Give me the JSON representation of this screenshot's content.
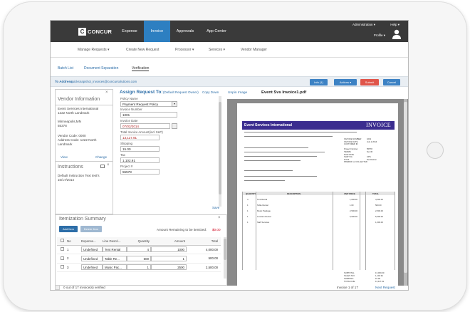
{
  "nav": {
    "logo": "CONCUR",
    "logo_icon_letter": "C",
    "tabs": [
      {
        "label": "Expense"
      },
      {
        "label": "Invoice"
      },
      {
        "label": "Approvals"
      },
      {
        "label": "App Center"
      }
    ],
    "administration": "Administration ▾",
    "help": "Help ▾",
    "profile": "Profile ▾"
  },
  "subnav": {
    "items": [
      {
        "label": "Manage Requests ▾"
      },
      {
        "label": "Create New Request"
      },
      {
        "label": "Processor ▾"
      },
      {
        "label": "Services ▾"
      },
      {
        "label": "Vendor Manager"
      }
    ]
  },
  "toolbar": {
    "items": [
      {
        "label": "Batch List"
      },
      {
        "label": "Document Separation"
      },
      {
        "label": "Verification"
      }
    ]
  },
  "address": {
    "label": "To Address:",
    "value": "quicksnapshot_invoices@concursolutions.com",
    "info": "Info (1)",
    "actions": "Actions ▾",
    "submit": "Submit",
    "cancel": "Cancel"
  },
  "vendor": {
    "title": "Vendor Information",
    "name": "Event Services International",
    "addr1": "1222 North Landmark",
    "addr2": "Minneapolis,MN",
    "addr3": "55378",
    "vcode": "Vendor Code: 0000",
    "acode": "Address Code: 1222 North",
    "acode2": "Landmark",
    "view": "View",
    "change": "Change"
  },
  "instructions": {
    "title": "Instructions",
    "text": "Default Instruction Text test's 10/17/2014"
  },
  "assign": {
    "title": "Assign Request To:",
    "owner": "(Default Request Owner)",
    "copydown": "Copy Down",
    "unpin": "Unpin Image",
    "filename": "Event Svs Invoice1.pdf"
  },
  "form": {
    "policy_label": "Policy Name",
    "policy_value": "Payment Request Policy",
    "invoice_label": "Invoice Number",
    "invoice_value": "1001",
    "date_label": "Invoice Date",
    "date_value": "07/02/2014",
    "total_label": "Total Invoice Amount(incl S&T)",
    "total_value": "13,117.91",
    "shipping_label": "Shipping",
    "shipping_value": "15.00",
    "tax_label": "Tax",
    "tax_value": "1,102.91",
    "project_label": "Project #",
    "project_value": "55578",
    "save": "Save"
  },
  "itemization": {
    "title": "Itemization Summary",
    "add": "Add Item",
    "delete": "Delete Item",
    "remaining_label": "Amount Remaining to be itemized:",
    "remaining_value": "$0.00",
    "headers": [
      "No",
      "Expense...",
      "Line Descri...",
      "Quantity",
      "Amount",
      "Total"
    ],
    "rows": [
      {
        "no": "1",
        "expense": "Undefined",
        "desc": "Tent Rental",
        "qty": "4",
        "amount": "1000",
        "total": "4,000.00"
      },
      {
        "no": "2",
        "expense": "Undefined",
        "desc": "Table Re...",
        "qty": "500",
        "amount": "1",
        "total": "500.00"
      },
      {
        "no": "3",
        "expense": "Undefined",
        "desc": "Music Pac...",
        "qty": "1",
        "amount": "2500",
        "total": "2,500.00"
      }
    ]
  },
  "invoice": {
    "company": "Event Services International",
    "word": "INVOICE",
    "cols": [
      "QUANTITY",
      "DESCRIPTION",
      "UNIT PRICE",
      "TOTAL"
    ],
    "lines": [
      {
        "q": "4",
        "d": "Tent Rental",
        "u": "1,000.00",
        "t": "4,000.00"
      },
      {
        "q": "1",
        "d": "Table Rental",
        "u": "1.00",
        "t": "500.00"
      },
      {
        "q": "1",
        "d": "Music Package",
        "u": "2,500.00",
        "t": "2,500.00"
      },
      {
        "q": "1",
        "d": "Location Rental",
        "u": "5,000.00",
        "t": "5,000.00"
      },
      {
        "q": "1",
        "d": "Staff Services",
        "u": "",
        "t": "1,000.00"
      }
    ],
    "sum_labels": [
      "SUBTOTAL",
      "SALES TAX",
      "SHIPPING",
      "TOTAL DUE"
    ],
    "sum_vals": [
      "13,000.00",
      "1,102.91",
      "15.00",
      "13,117.91"
    ],
    "info_labels": [
      "INVOICE NUMBER",
      "INVOICE DATE",
      "CUSTOMER ID",
      "",
      "Project Number",
      "TERMS",
      "DUE DATE",
      "SHIP VIA",
      "F.O.B.",
      "PREPAID or COLLECTED"
    ],
    "info_vals": [
      "1001",
      "July 2 2014",
      "",
      "",
      "55578",
      "Net 30",
      "",
      "UPS",
      "Destination",
      ""
    ]
  },
  "status": {
    "left": "0 out of 17 invoice(s) verified",
    "page": "Invoice 1 of 17",
    "next": "Next Request"
  }
}
